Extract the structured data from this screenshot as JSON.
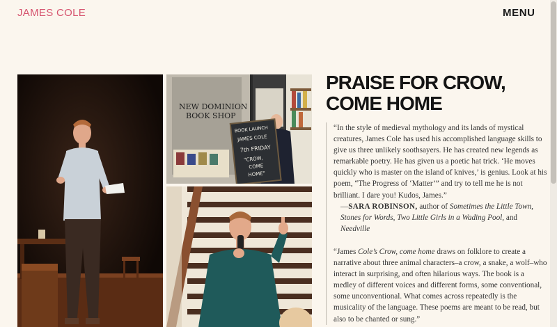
{
  "header": {
    "brand": "JAMES COLE",
    "menu_label": "MENU"
  },
  "colors": {
    "background": "#fbf6ee",
    "brand": "#d6546f",
    "text": "#141414"
  },
  "photos": {
    "sign": {
      "shop_name_line1": "NEW DOMINION",
      "shop_name_line2": "BOOK SHOP",
      "chalk_line1": "BOOK LAUNCH",
      "chalk_line2": "JAMES COLE",
      "chalk_line3": "7th FRIDAY",
      "chalk_line4": "\"CROW,",
      "chalk_line5": "COME",
      "chalk_line6": "HOME\""
    }
  },
  "praise": {
    "title": "PRAISE FOR CROW, COME HOME",
    "quotes": [
      {
        "text": "“In the style of medieval mythology and its lands of mystical creatures, James Cole has used his accomplished language skills to give us three unlikely soothsayers. He has created new legends as remarkable poetry. He has given us a poetic hat trick. ‘He moves quickly who is master on the island of knives,’ is genius. Look at his poem, “The Progress of ‘Matter’” and try to tell me he is not brilliant. I dare you! Kudos, James.”",
        "attr_name": "SARA ROBINSON,",
        "attr_prefix": " author of ",
        "attr_works": "Sometimes the Little Town, Stones for Words, Two Little Girls in a Wading Pool,",
        "attr_and": " and ",
        "attr_last": "Needville"
      },
      {
        "text_a": "“James ",
        "text_b": "Cole’s Crow, come home",
        "text_c": " draws on folklore to create a narrative about three animal characters–a crow, a snake, a wolf–who interact in surprising, and often hilarious ways. The book is a medley of different voices and different forms, some conventional, some unconventional. What comes across repeatedly is the musicality of the language. These poems are meant to be read, but also to be chanted or sung.”"
      }
    ]
  }
}
